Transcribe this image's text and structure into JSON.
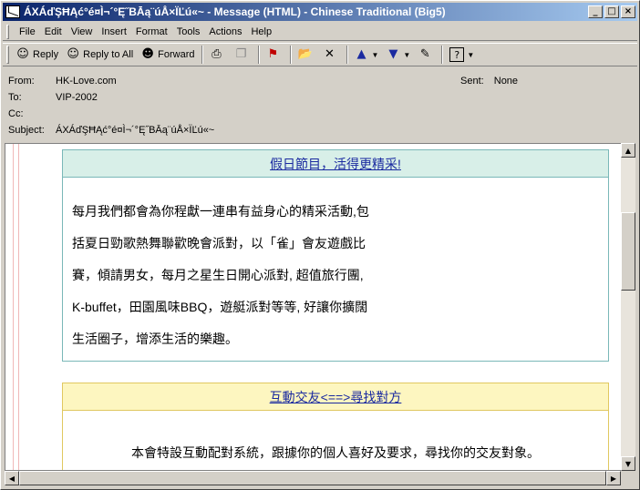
{
  "window": {
    "title": "ÁXÁďŞĦĄć°é¤Ì¬´°Ę˝BĀą¨úÅ×ÏĽú«~ - Message (HTML)  - Chinese Traditional (Big5)",
    "minimize": "_",
    "maximize": "□",
    "close": "×"
  },
  "menu": [
    "File",
    "Edit",
    "View",
    "Insert",
    "Format",
    "Tools",
    "Actions",
    "Help"
  ],
  "toolbar": {
    "reply": "Reply",
    "reply_all": "Reply to All",
    "forward": "Forward"
  },
  "header": {
    "from_label": "From:",
    "from_value": "HK-Love.com",
    "to_label": "To:",
    "to_value": "VIP-2002",
    "cc_label": "Cc:",
    "cc_value": "",
    "subject_label": "Subject:",
    "subject_value": "ÁXÁďŞĦĄć°é¤Ì¬´°Ę˝BĀą¨úÅ×ÏĽú«~",
    "sent_label": "Sent:",
    "sent_value": "None"
  },
  "section1": {
    "title": "假日節目，活得更精采!",
    "lines": [
      "每月我們都會為你程獻一連串有益身心的精采活動,包",
      "括夏日勁歌熱舞聯歡晚會派對，以「雀」會友遊戲比",
      "賽，傾請男女，每月之星生日開心派對, 超值旅行團,",
      "K-buffet，田園風味BBQ，遊艇派對等等, 好讓你擴闊",
      "生活圈子，增添生活的樂趣。"
    ]
  },
  "section2": {
    "title": "互動交友<==>尋找對方",
    "line": "本會特設互動配對系統，跟據你的個人喜好及要求，尋找你的交友對象。"
  },
  "colors": {
    "title_gradient_start": "#0a246a",
    "title_gradient_end": "#a6caf0",
    "section1_header_bg": "#d8efe8",
    "section2_header_bg": "#fdf6c0",
    "link_color": "#1a2aa0"
  }
}
